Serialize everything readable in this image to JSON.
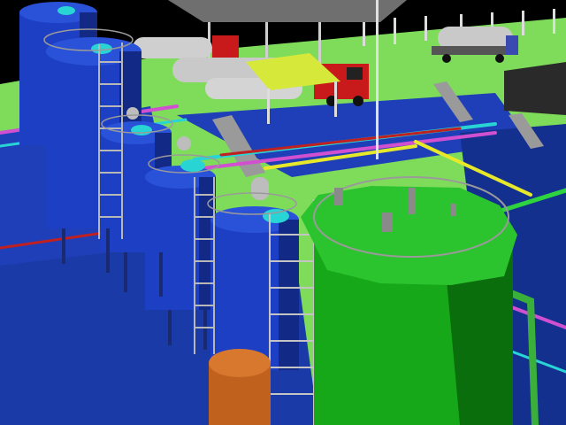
{
  "scene": {
    "colors": {
      "sky": "#000000",
      "grass": "#7fdc5a",
      "floor": "#1f3fb8",
      "floor_dark": "#14308f",
      "tank_blue": "#1d3fc4",
      "tank_blue_shade": "#122a86",
      "tank_green": "#17a81a",
      "tank_green_shade": "#0b6e0d",
      "tank_orange": "#c0621e",
      "tanker_silver": "#c9c9c9",
      "truck_red": "#c81a1a",
      "canopy": "#d6e83a",
      "roof": "#707070",
      "pipe_yellow": "#e8e82a",
      "pipe_red": "#c02020",
      "pipe_cyan": "#28d4d4",
      "pipe_magenta": "#d050d0",
      "ladder": "#b8b8b8",
      "railing": "#9a9a9a"
    }
  }
}
